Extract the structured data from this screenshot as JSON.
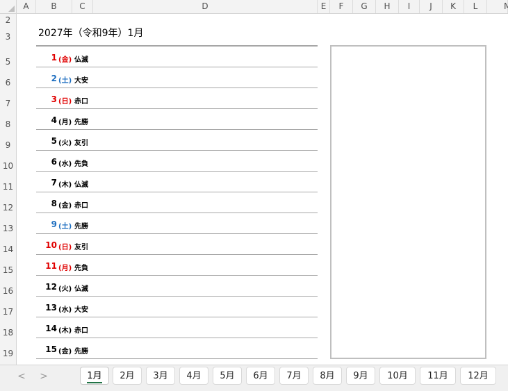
{
  "column_headers": [
    "A",
    "B",
    "C",
    "D",
    "E",
    "F",
    "G",
    "H",
    "I",
    "J",
    "K",
    "L",
    "M"
  ],
  "row_numbers": [
    "2",
    "3",
    "5",
    "6",
    "7",
    "8",
    "9",
    "10",
    "11",
    "12",
    "13",
    "14",
    "15",
    "16",
    "17",
    "18",
    "19"
  ],
  "title": "2027年（令和9年）1月",
  "days": [
    {
      "day": "1",
      "weekday": "(金)",
      "rokuyo": "仏滅",
      "color": "#e00000"
    },
    {
      "day": "2",
      "weekday": "(土)",
      "rokuyo": "大安",
      "color": "#1f6fc0"
    },
    {
      "day": "3",
      "weekday": "(日)",
      "rokuyo": "赤口",
      "color": "#e00000"
    },
    {
      "day": "4",
      "weekday": "(月)",
      "rokuyo": "先勝",
      "color": "#000000"
    },
    {
      "day": "5",
      "weekday": "(火)",
      "rokuyo": "友引",
      "color": "#000000"
    },
    {
      "day": "6",
      "weekday": "(水)",
      "rokuyo": "先負",
      "color": "#000000"
    },
    {
      "day": "7",
      "weekday": "(木)",
      "rokuyo": "仏滅",
      "color": "#000000"
    },
    {
      "day": "8",
      "weekday": "(金)",
      "rokuyo": "赤口",
      "color": "#000000"
    },
    {
      "day": "9",
      "weekday": "(土)",
      "rokuyo": "先勝",
      "color": "#1f6fc0"
    },
    {
      "day": "10",
      "weekday": "(日)",
      "rokuyo": "友引",
      "color": "#e00000"
    },
    {
      "day": "11",
      "weekday": "(月)",
      "rokuyo": "先負",
      "color": "#e00000"
    },
    {
      "day": "12",
      "weekday": "(火)",
      "rokuyo": "仏滅",
      "color": "#000000"
    },
    {
      "day": "13",
      "weekday": "(水)",
      "rokuyo": "大安",
      "color": "#000000"
    },
    {
      "day": "14",
      "weekday": "(木)",
      "rokuyo": "赤口",
      "color": "#000000"
    },
    {
      "day": "15",
      "weekday": "(金)",
      "rokuyo": "先勝",
      "color": "#000000"
    }
  ],
  "nav": {
    "prev": "<",
    "next": ">",
    "prev_icon": "chevron-left-icon",
    "next_icon": "chevron-right-icon"
  },
  "tabs": [
    "1月",
    "2月",
    "3月",
    "4月",
    "5月",
    "6月",
    "7月",
    "8月",
    "9月",
    "10月",
    "11月",
    "12月"
  ],
  "active_tab": "1月",
  "colors": {
    "sunday_holiday": "#e00000",
    "saturday": "#1f6fc0",
    "weekday": "#000000",
    "active_tab_underline": "#217346"
  }
}
